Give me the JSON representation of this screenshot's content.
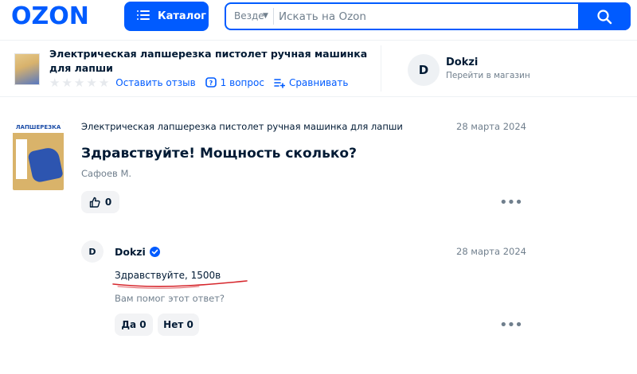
{
  "header": {
    "logo": "OZON",
    "catalog_label": "Каталог",
    "search_scope": "Везде",
    "search_placeholder": "Искать на Ozon"
  },
  "product_bar": {
    "title": "Электрическая лапшерезка пистолет ручная машинка для лапши",
    "rating_stars": 0,
    "review_link": "Оставить отзыв",
    "questions_link": "1 вопрос",
    "compare_link": "Сравнивать",
    "seller_initial": "D",
    "seller_name": "Dokzi",
    "seller_link": "Перейти в магазин"
  },
  "question": {
    "product_name": "Электрическая лапшерезка пистолет ручная машинка для лапши",
    "date": "28 марта 2024",
    "text": "Здравствуйте! Мощность сколько?",
    "author": "Сафоев М.",
    "likes": "0",
    "thumb_label": "ЛАПШЕРЕЗКА"
  },
  "answer": {
    "initial": "D",
    "seller": "Dokzi",
    "date": "28 марта 2024",
    "text": "Здравствуйте, 1500в",
    "helpful_prompt": "Вам помог этот ответ?",
    "yes_label": "Да 0",
    "no_label": "Нет 0"
  },
  "colors": {
    "brand": "#005bff",
    "text": "#001a34",
    "muted": "#707f8d",
    "annotation": "#d6262c"
  }
}
